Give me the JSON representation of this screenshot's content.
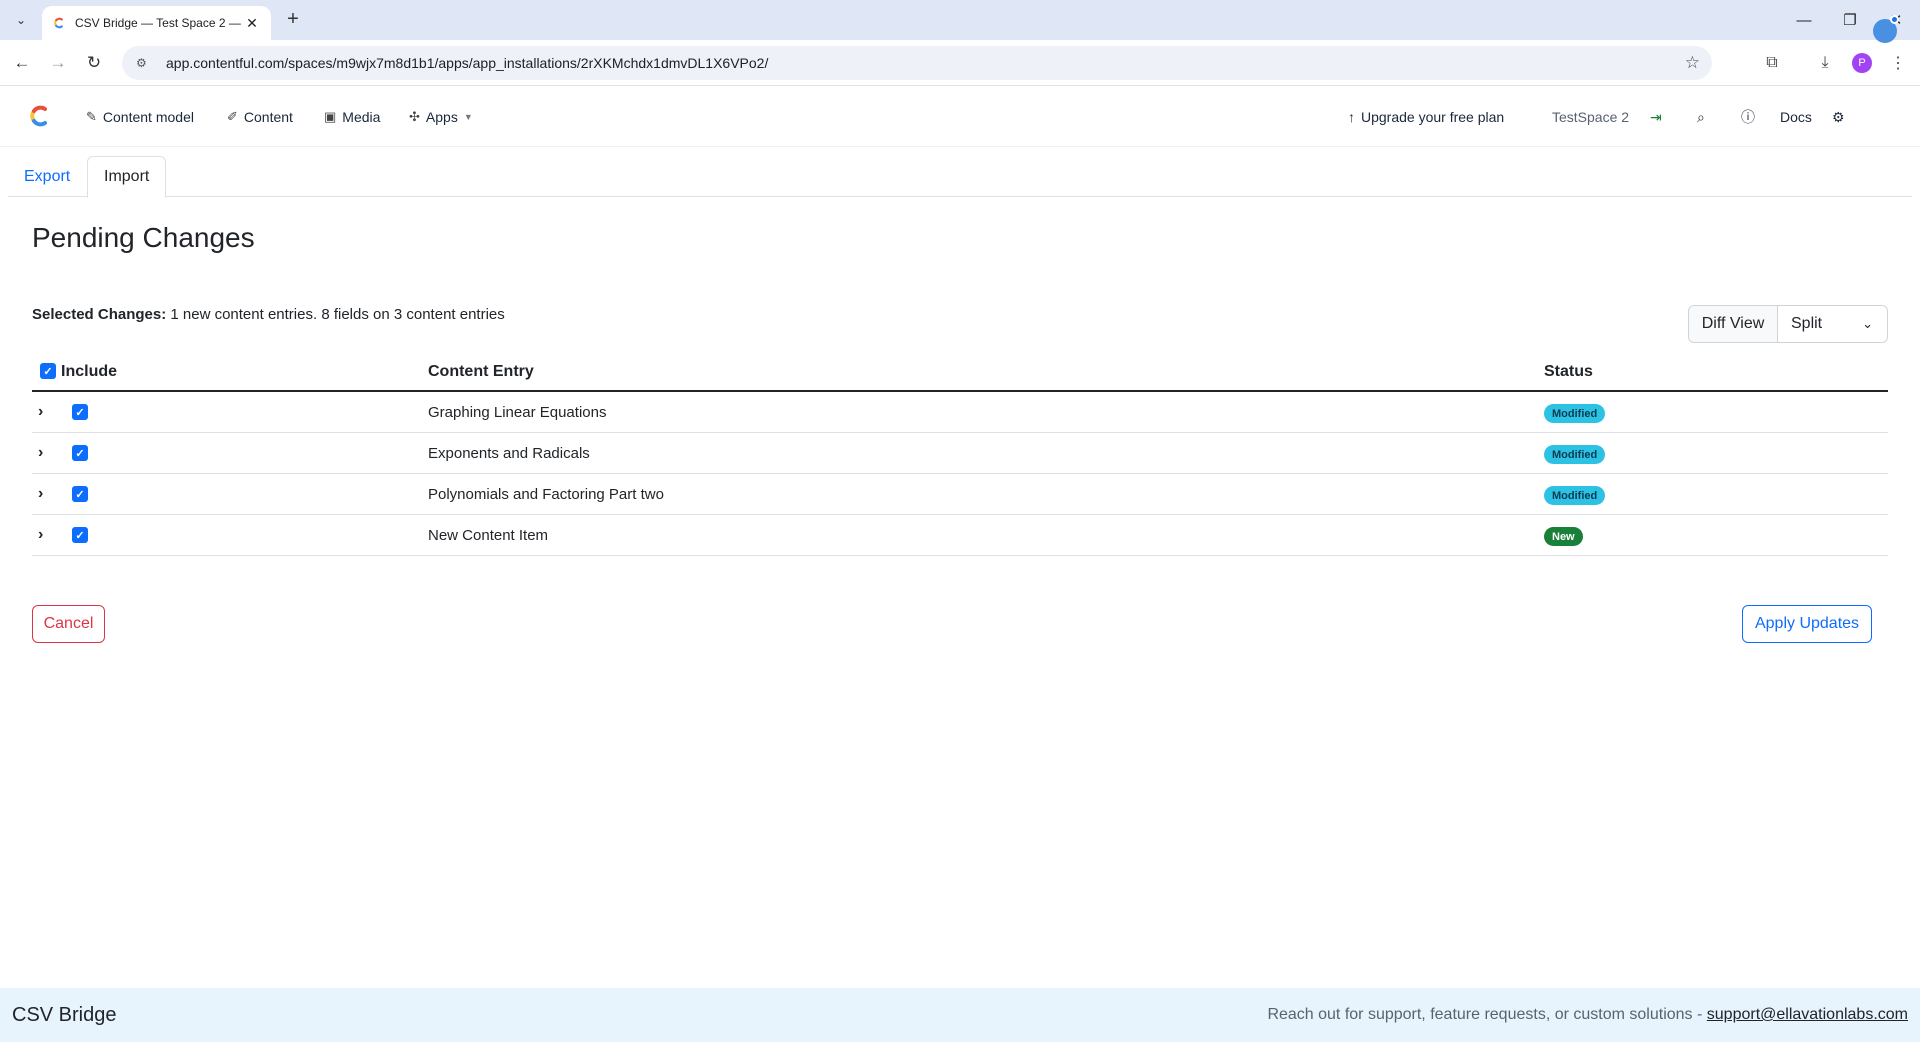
{
  "browser": {
    "tab_title": "CSV Bridge — Test Space 2 — Co",
    "url": "app.contentful.com/spaces/m9wjx7m8d1b1/apps/app_installations/2rXKMchdx1dmvDL1X6VPo2/",
    "profile_initial": "P"
  },
  "header": {
    "nav": {
      "content_model": "Content model",
      "content": "Content",
      "media": "Media",
      "apps": "Apps"
    },
    "upgrade": "Upgrade your free plan",
    "space": "TestSpace 2",
    "docs": "Docs"
  },
  "tabs": {
    "export": "Export",
    "import": "Import"
  },
  "page": {
    "title": "Pending Changes",
    "summary_label": "Selected Changes:",
    "summary_text": "1 new content entries. 8 fields on 3 content entries"
  },
  "diff": {
    "label": "Diff View",
    "value": "Split"
  },
  "table": {
    "headers": {
      "include": "Include",
      "entry": "Content Entry",
      "status": "Status"
    },
    "rows": [
      {
        "entry": "Graphing Linear Equations",
        "status": "Modified",
        "checked": true
      },
      {
        "entry": "Exponents and Radicals",
        "status": "Modified",
        "checked": true
      },
      {
        "entry": "Polynomials and Factoring Part two",
        "status": "Modified",
        "checked": true
      },
      {
        "entry": "New Content Item",
        "status": "New",
        "checked": true
      }
    ]
  },
  "actions": {
    "cancel": "Cancel",
    "apply": "Apply Updates"
  },
  "footer": {
    "brand": "CSV Bridge",
    "text": "Reach out for support, feature requests, or custom solutions - ",
    "email": "support@ellavationlabs.com"
  },
  "colors": {
    "modified": "#2cc2e3",
    "new": "#188038",
    "primary": "#0d6efd",
    "danger": "#dc3545"
  }
}
